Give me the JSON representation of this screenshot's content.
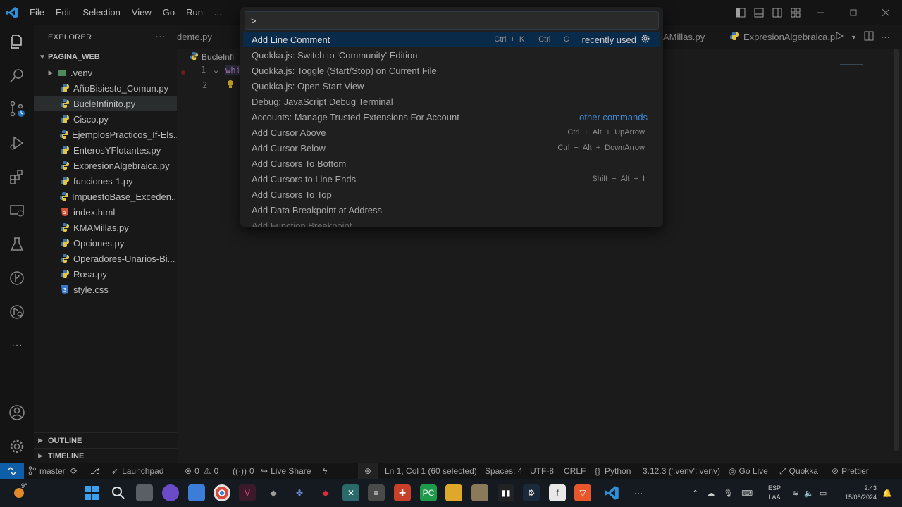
{
  "menu": [
    "File",
    "Edit",
    "Selection",
    "View",
    "Go",
    "Run",
    "..."
  ],
  "explorer": {
    "title": "EXPLORER",
    "folder": "PAGINA_WEB",
    "items": [
      {
        "name": ".venv",
        "type": "folder"
      },
      {
        "name": "AñoBisiesto_Comun.py",
        "type": "py"
      },
      {
        "name": "BucleInfinito.py",
        "type": "py",
        "selected": true
      },
      {
        "name": "Cisco.py",
        "type": "py"
      },
      {
        "name": "EjemplosPracticos_If-Els...",
        "type": "py"
      },
      {
        "name": "EnterosYFlotantes.py",
        "type": "py"
      },
      {
        "name": "ExpresionAlgebraica.py",
        "type": "py"
      },
      {
        "name": "funciones-1.py",
        "type": "py"
      },
      {
        "name": "ImpuestoBase_Exceden...",
        "type": "py"
      },
      {
        "name": "index.html",
        "type": "html"
      },
      {
        "name": "KMAMillas.py",
        "type": "py"
      },
      {
        "name": "Opciones.py",
        "type": "py"
      },
      {
        "name": "Operadores-Unarios-Bi...",
        "type": "py"
      },
      {
        "name": "Rosa.py",
        "type": "py"
      },
      {
        "name": "style.css",
        "type": "css"
      }
    ],
    "outline": "OUTLINE",
    "timeline": "TIMELINE"
  },
  "tabs": {
    "left_partial": "dente.py",
    "right_partial": "AMillas.py",
    "active_right": "ExpresionAlgebraica.p"
  },
  "breadcrumb": "BucleInfi",
  "editor": {
    "code_partial": "whi",
    "line_numbers": [
      "1",
      "2"
    ]
  },
  "palette": {
    "input_value": ">",
    "commands": [
      {
        "label": "Add Line Comment",
        "active": true,
        "keys": [
          "Ctrl",
          "+",
          "K",
          "Ctrl",
          "+",
          "C"
        ],
        "badge": "recently used"
      },
      {
        "label": "Quokka.js: Switch to 'Community' Edition"
      },
      {
        "label": "Quokka.js: Toggle (Start/Stop) on Current File"
      },
      {
        "label": "Quokka.js: Open Start View"
      },
      {
        "label": "Debug: JavaScript Debug Terminal"
      },
      {
        "label": "Accounts: Manage Trusted Extensions For Account",
        "link": "other commands"
      },
      {
        "label": "Add Cursor Above",
        "keys": [
          "Ctrl",
          "+",
          "Alt",
          "+",
          "UpArrow"
        ]
      },
      {
        "label": "Add Cursor Below",
        "keys": [
          "Ctrl",
          "+",
          "Alt",
          "+",
          "DownArrow"
        ]
      },
      {
        "label": "Add Cursors To Bottom"
      },
      {
        "label": "Add Cursors to Line Ends",
        "keys": [
          "Shift",
          "+",
          "Alt",
          "+",
          "I"
        ]
      },
      {
        "label": "Add Cursors To Top"
      },
      {
        "label": "Add Data Breakpoint at Address"
      },
      {
        "label": "Add Function Breakpoint",
        "faded": true
      }
    ]
  },
  "statusbar": {
    "branch": "master",
    "launchpad": "Launchpad",
    "errors": "0",
    "warnings": "0",
    "ports": "0",
    "liveshare": "Live Share",
    "position": "Ln 1, Col 1 (60 selected)",
    "spaces": "Spaces: 4",
    "encoding": "UTF-8",
    "eol": "CRLF",
    "language": "Python",
    "interpreter": "3.12.3 ('.venv': venv)",
    "golive": "Go Live",
    "quokka": "Quokka",
    "prettier": "Prettier"
  },
  "taskbar": {
    "weather": "9°",
    "lang_top": "ESP",
    "lang_bottom": "LAA",
    "time": "2:43",
    "date": "15/06/2024"
  },
  "colors": {
    "accent": "#0f5fa8",
    "active_row": "#0a2a4a",
    "link": "#3c8ad6"
  }
}
